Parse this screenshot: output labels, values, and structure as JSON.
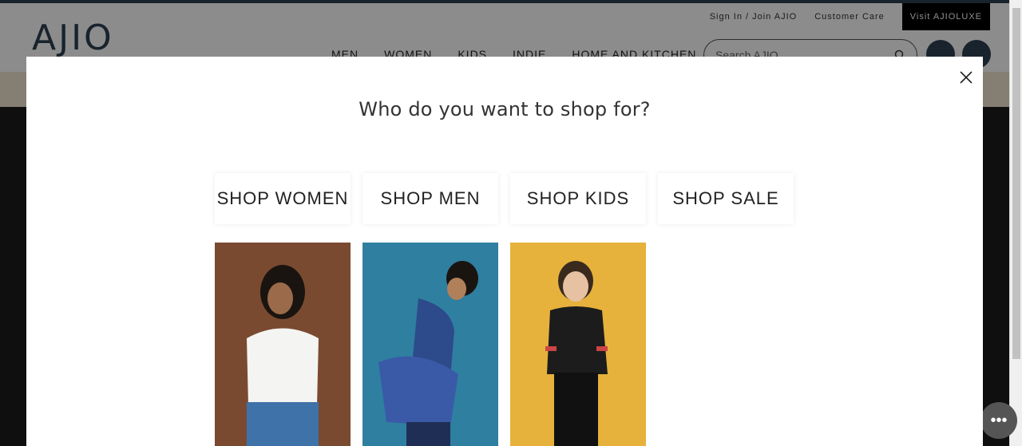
{
  "header": {
    "logo": "AJIO",
    "top_links": [
      "Sign In / Join AJIO",
      "Customer Care"
    ],
    "luxe_label": "Visit AJIOLUXE",
    "nav": [
      "MEN",
      "WOMEN",
      "KIDS",
      "INDIE",
      "HOME AND KITCHEN"
    ],
    "search_placeholder": "Search AJIO"
  },
  "modal": {
    "title": "Who do you want to shop for?",
    "buttons": [
      "SHOP WOMEN",
      "SHOP MEN",
      "SHOP KIDS",
      "SHOP SALE"
    ]
  },
  "colors": {
    "brand": "#2c4152",
    "strip": "#f3e6cf",
    "women_bg": "#7a4a30",
    "men_bg": "#2f7fa0",
    "kids_bg": "#e6b23c"
  }
}
